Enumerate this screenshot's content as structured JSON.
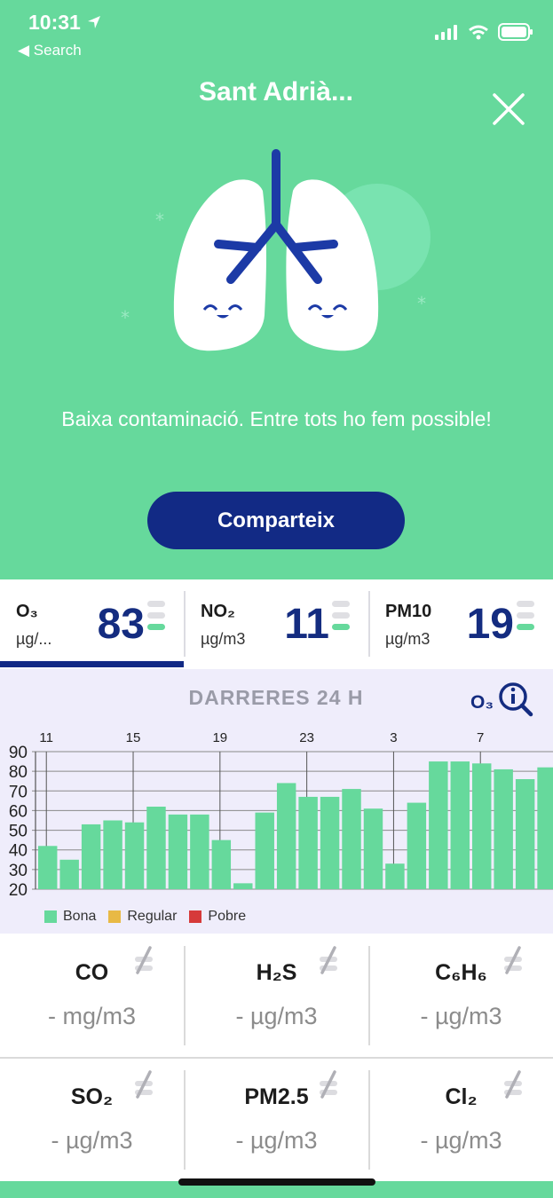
{
  "status": {
    "time": "10:31",
    "back": "◀ Search"
  },
  "hero": {
    "city": "Sant Adrià...",
    "message": "Baixa contaminació. Entre tots ho fem possible!",
    "share_label": "Comparteix"
  },
  "pollutants": [
    {
      "name": "O₃",
      "unit": "µg/...",
      "value": "83",
      "active": true,
      "level": "good"
    },
    {
      "name": "NO₂",
      "unit": "µg/m3",
      "value": "11",
      "active": false,
      "level": "good"
    },
    {
      "name": "PM10",
      "unit": "µg/m3",
      "value": "19",
      "active": false,
      "level": "good"
    }
  ],
  "chart_panel": {
    "title": "DARRERES 24 H",
    "info_label": "O₃",
    "legend": [
      {
        "label": "Bona",
        "color": "#66d99c"
      },
      {
        "label": "Regular",
        "color": "#e8b945"
      },
      {
        "label": "Pobre",
        "color": "#d63a3a"
      }
    ]
  },
  "chart_data": {
    "type": "bar",
    "x_tick_labels": [
      "11",
      "15",
      "19",
      "23",
      "3",
      "7"
    ],
    "values": [
      42,
      35,
      53,
      55,
      54,
      62,
      58,
      58,
      45,
      23,
      59,
      74,
      67,
      67,
      71,
      61,
      33,
      64,
      85,
      85,
      84,
      81,
      76,
      82
    ],
    "y_ticks": [
      20,
      30,
      40,
      50,
      60,
      70,
      80,
      90
    ],
    "ylim": [
      20,
      90
    ],
    "grid": true,
    "color": "#66d99c"
  },
  "measures": [
    {
      "name": "CO",
      "unit": "- mg/m3"
    },
    {
      "name": "H₂S",
      "unit": "- µg/m3"
    },
    {
      "name": "C₆H₆",
      "unit": "- µg/m3"
    },
    {
      "name": "SO₂",
      "unit": "- µg/m3"
    },
    {
      "name": "PM2.5",
      "unit": "- µg/m3"
    },
    {
      "name": "Cl₂",
      "unit": "- µg/m3"
    }
  ],
  "colors": {
    "brand_green": "#66d99c",
    "brand_navy": "#122a85"
  }
}
